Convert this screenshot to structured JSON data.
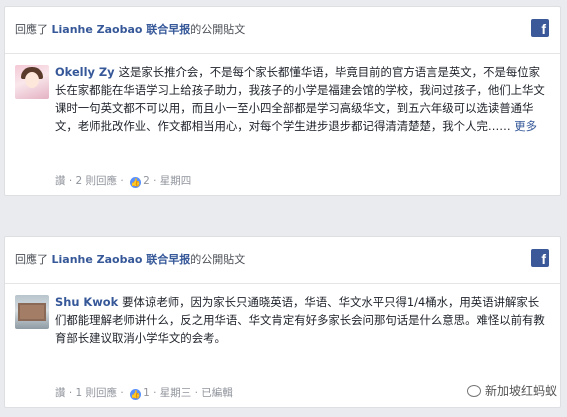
{
  "posts": [
    {
      "header_prefix": "回應了",
      "page_name": "Lianhe Zaobao 联合早报",
      "header_suffix": "的公開貼文",
      "fb_icon_glyph": "f",
      "author": "Okelly Zy",
      "comment": "这是家长推介会，不是每个家长都懂华语，毕竟目前的官方语言是英文，不是每位家长在家都能在华语学习上给孩子助力，我孩子的小学是福建会馆的学校，我问过孩子，他们上华文课时一句英文都不可以用，而且小一至小四全部都是学习高级华文，到五六年级可以选读普通华文，老师批改作业、作文都相当用心，对每个学生进步退步都记得清清楚楚，我个人完……",
      "more_label": "更多",
      "actions": [
        "讚",
        "2 則回應",
        "2",
        "星期四"
      ]
    },
    {
      "header_prefix": "回應了",
      "page_name": "Lianhe Zaobao 联合早报",
      "header_suffix": "的公開貼文",
      "fb_icon_glyph": "f",
      "author": "Shu Kwok",
      "comment": "要体谅老师，因为家长只通晓英语，华语、华文水平只得1/4桶水，用英语讲解家长们都能理解老师讲什么，反之用华语、华文肯定有好多家长会问那句话是什么意思。难怪以前有教育部长建议取消小学华文的会考。",
      "actions": [
        "讚",
        "1 則回應",
        "1",
        "星期三",
        "已編輯"
      ]
    }
  ],
  "watermark": "新加坡红蚂蚁"
}
